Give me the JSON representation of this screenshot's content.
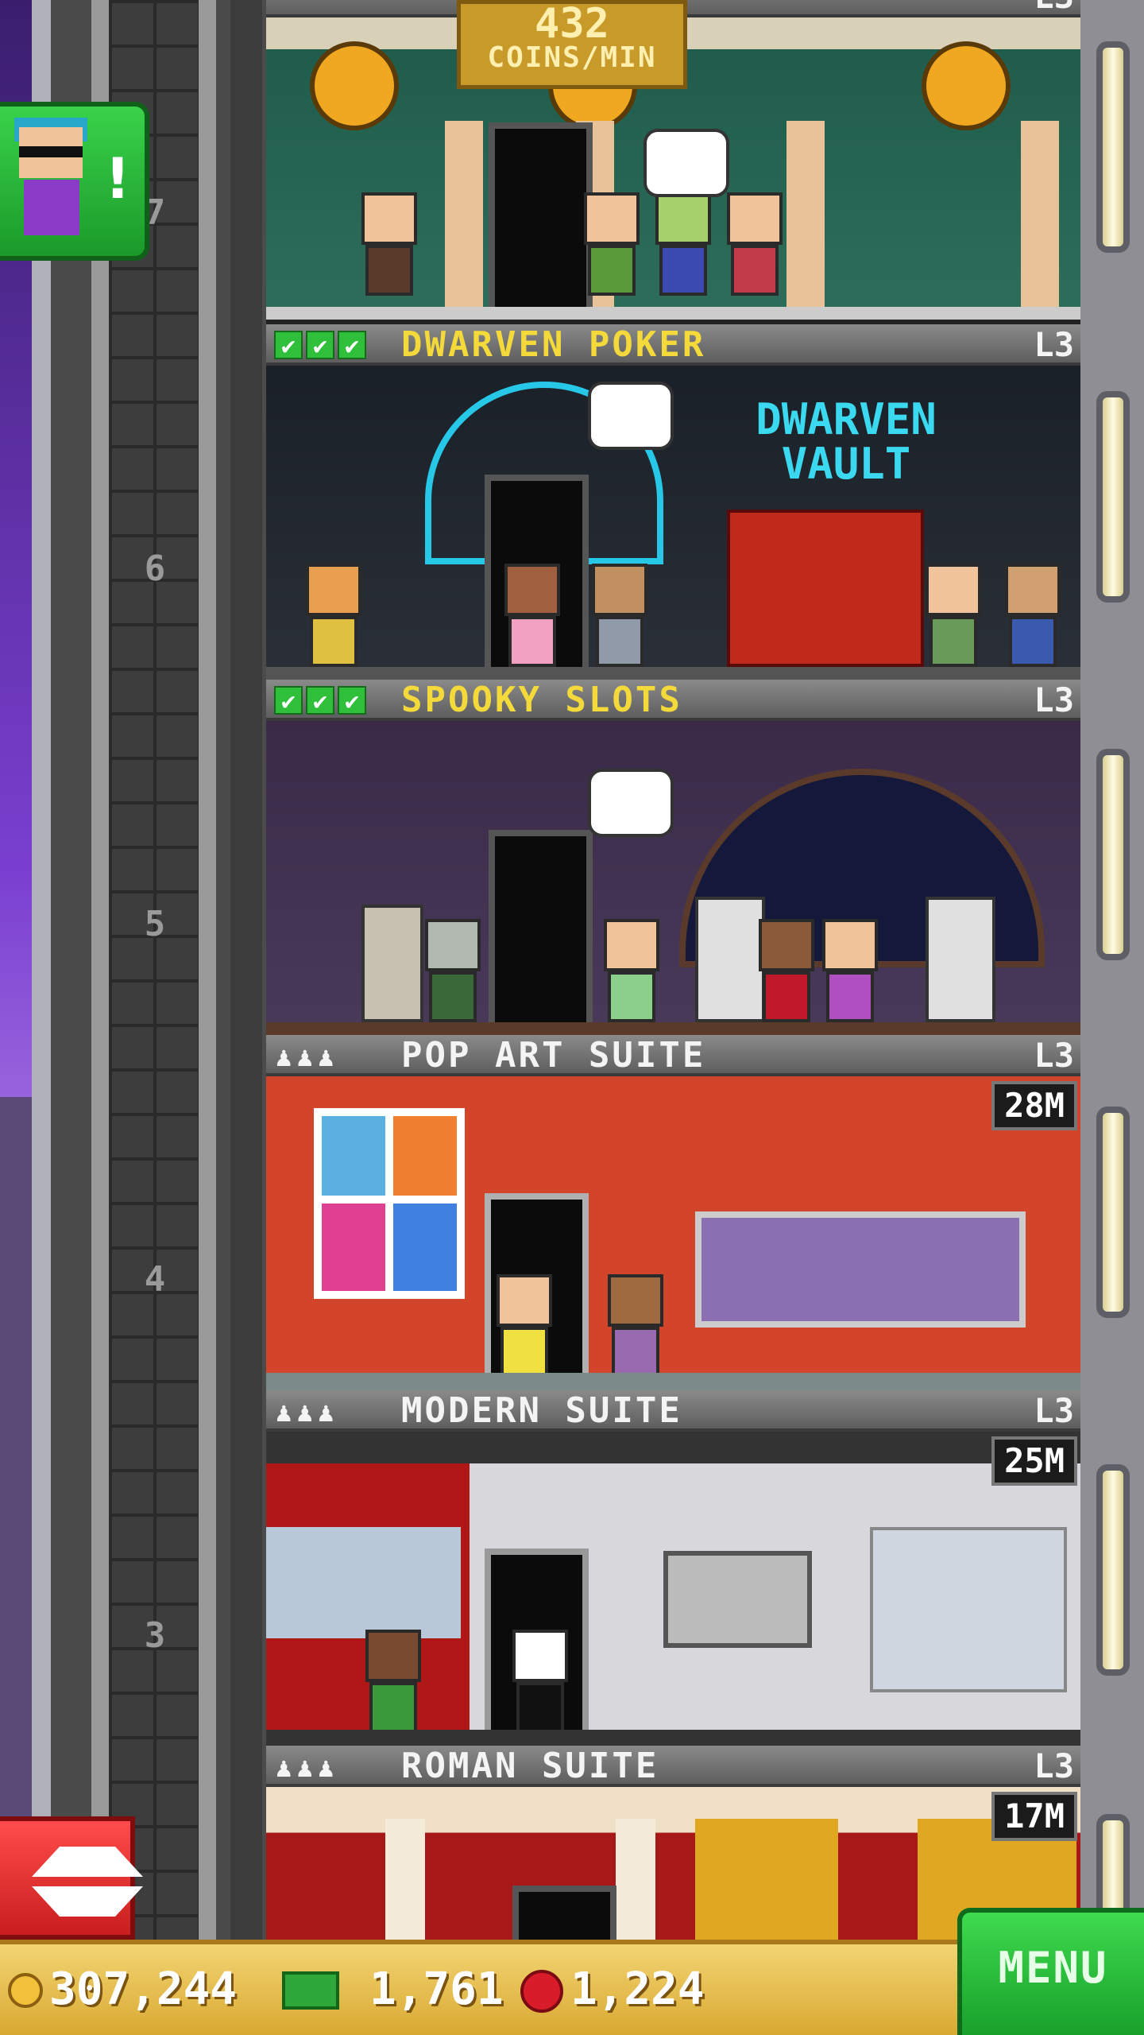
{
  "coins_per_min": {
    "value": "432",
    "unit": "COINS/MIN"
  },
  "shaft": {
    "floor_numbers": [
      "7",
      "6",
      "5",
      "4",
      "3"
    ]
  },
  "floors": [
    {
      "name": "",
      "level": "L3",
      "completed": true
    },
    {
      "name": "DWARVEN POKER",
      "level": "L3",
      "completed": true,
      "sign_text": "DWARVEN VAULT"
    },
    {
      "name": "SPOOKY SLOTS",
      "level": "L3",
      "completed": true
    },
    {
      "name": "POP ART SUITE",
      "level": "L3",
      "timer": "28M"
    },
    {
      "name": "MODERN SUITE",
      "level": "L3",
      "timer": "25M"
    },
    {
      "name": "ROMAN SUITE",
      "level": "L3",
      "timer": "17M"
    }
  ],
  "visitor": {
    "icon": "visitor-avatar-icon",
    "badge": "!"
  },
  "bottom_bar": {
    "coins": "307,244",
    "bux": "1,761",
    "gems": "1,224",
    "menu_label": "MENU"
  },
  "colors": {
    "shop_label_text": "#f4d93a",
    "suite_label_text": "#f4f4f4",
    "menu_button": "#2fbf3a",
    "elevator_button": "#e02a2a"
  }
}
